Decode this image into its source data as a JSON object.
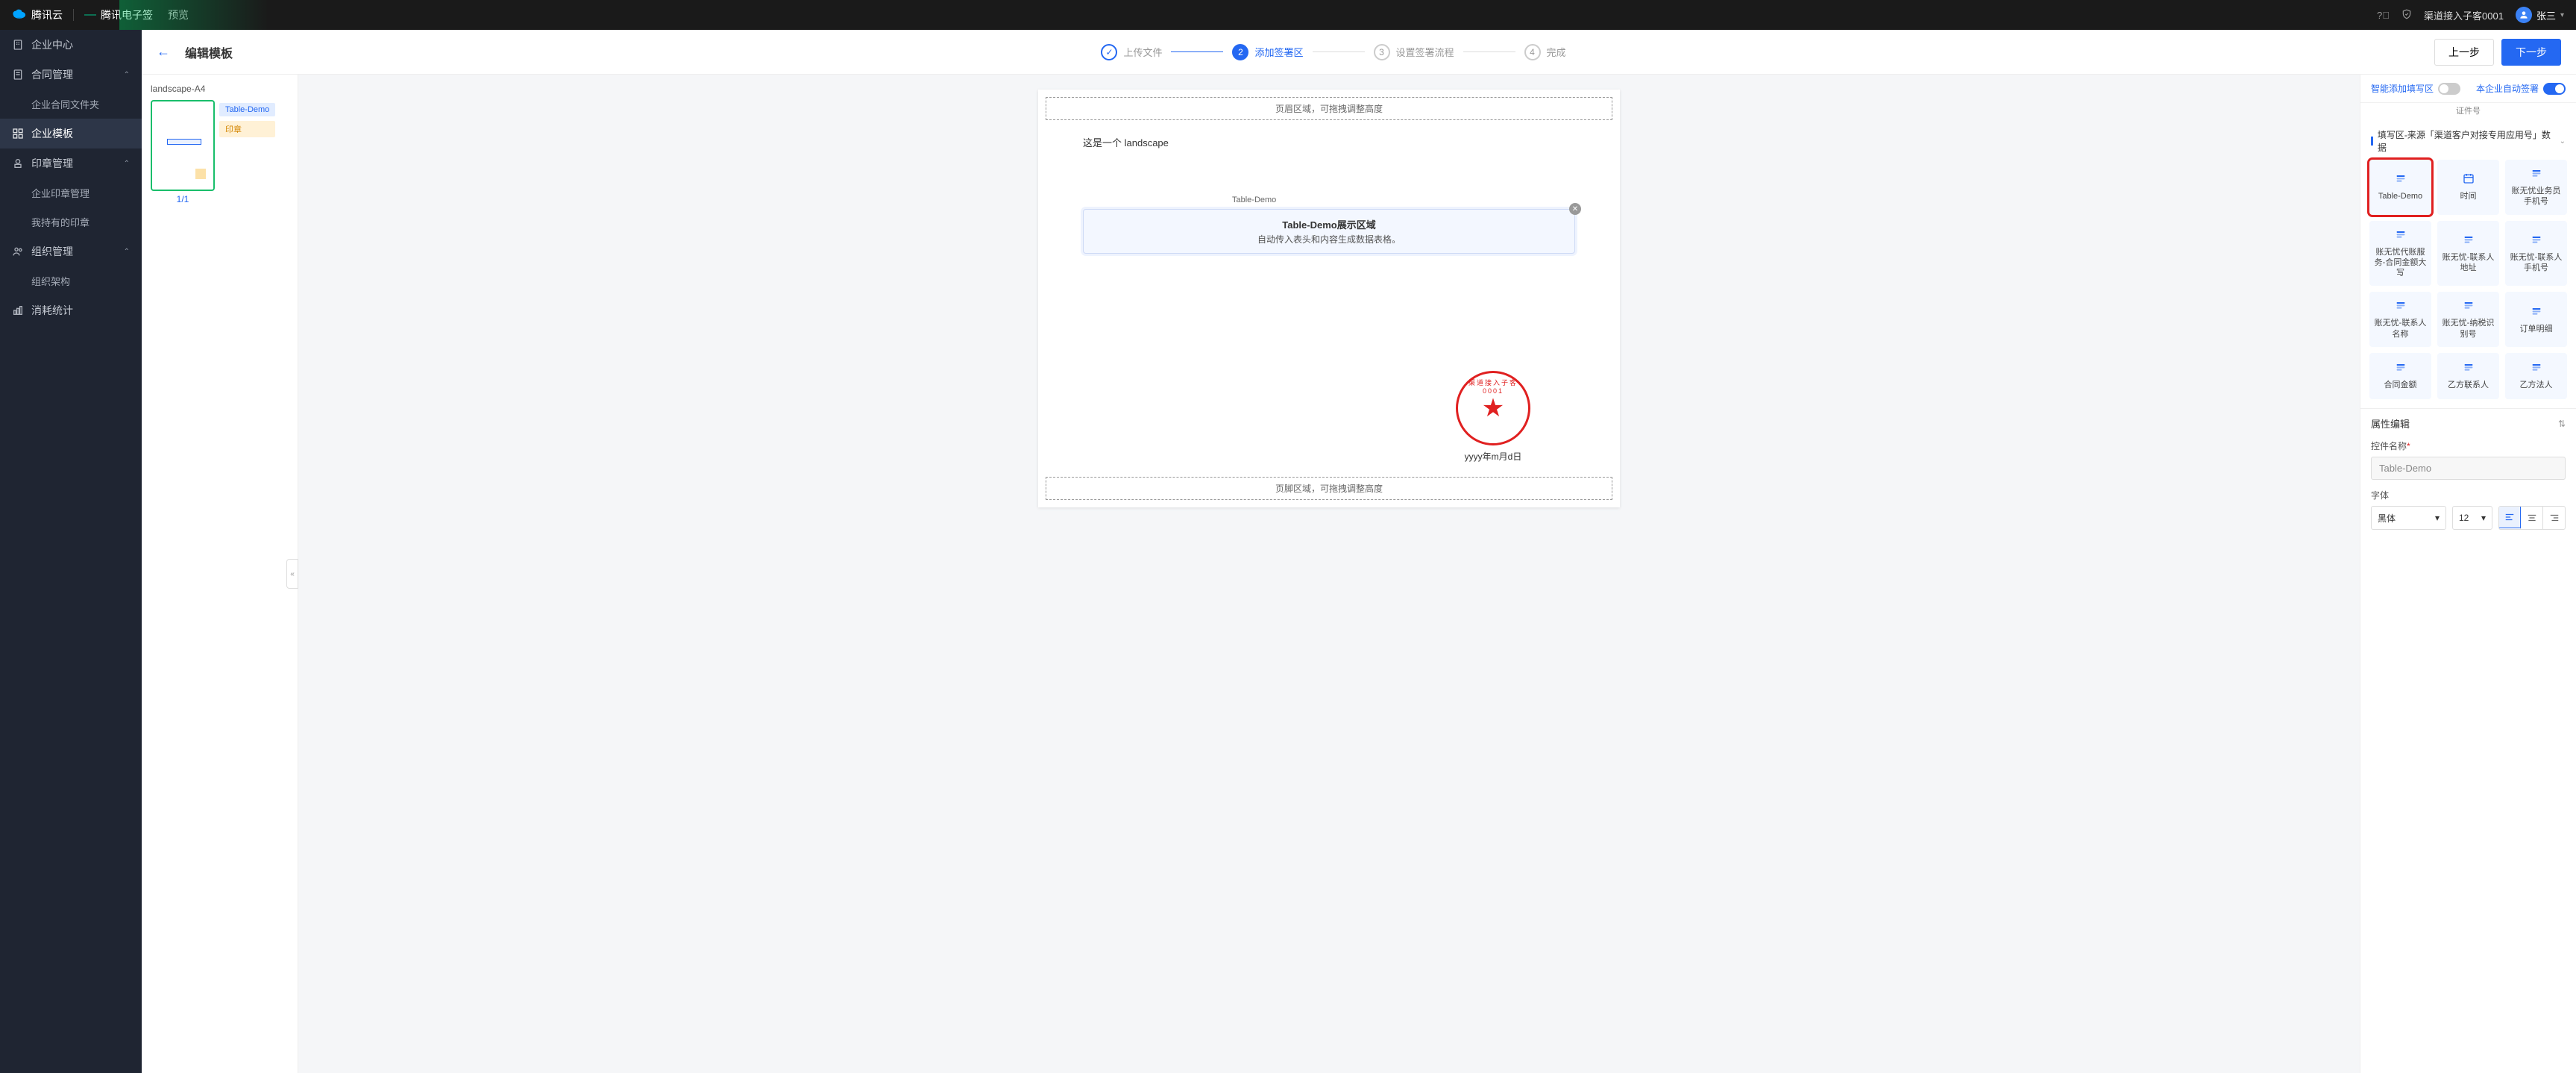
{
  "topbar": {
    "brand": "腾讯云",
    "product": "腾讯电子签",
    "mode": "预览",
    "org": "渠道接入子客0001",
    "username": "张三"
  },
  "sidebar": {
    "items": [
      {
        "label": "企业中心",
        "icon": "building",
        "type": "item"
      },
      {
        "label": "合同管理",
        "icon": "doc",
        "type": "group",
        "expanded": true
      },
      {
        "label": "企业合同文件夹",
        "type": "child"
      },
      {
        "label": "企业模板",
        "icon": "grid",
        "type": "item",
        "active": true
      },
      {
        "label": "印章管理",
        "icon": "stamp",
        "type": "group",
        "expanded": true
      },
      {
        "label": "企业印章管理",
        "type": "child"
      },
      {
        "label": "我持有的印章",
        "type": "child"
      },
      {
        "label": "组织管理",
        "icon": "users",
        "type": "group",
        "expanded": true
      },
      {
        "label": "组织架构",
        "type": "child"
      },
      {
        "label": "消耗统计",
        "icon": "chart",
        "type": "item"
      }
    ]
  },
  "header": {
    "title": "编辑模板",
    "steps": [
      {
        "label": "上传文件",
        "state": "done"
      },
      {
        "label": "添加签署区",
        "state": "active",
        "num": "2"
      },
      {
        "label": "设置签署流程",
        "state": "pending",
        "num": "3"
      },
      {
        "label": "完成",
        "state": "pending",
        "num": "4"
      }
    ],
    "prev": "上一步",
    "next": "下一步"
  },
  "thumb": {
    "docName": "landscape-A4",
    "pageNum": "1/1",
    "tags": [
      "Table-Demo",
      "印章"
    ]
  },
  "canvas": {
    "headerZone": "页眉区域，可拖拽调整高度",
    "footerZone": "页脚区域，可拖拽调整高度",
    "bodyText": "这是一个 landscape",
    "widget": {
      "label": "Table-Demo",
      "title": "Table-Demo展示区域",
      "desc": "自动传入表头和内容生成数据表格。"
    },
    "sealText": "渠道接入子客0001",
    "sealDate": "yyyy年m月d日"
  },
  "inspector": {
    "smartAdd": "智能添加填写区",
    "autoSign": "本企业自动签署",
    "idLabel": "证件号",
    "sectionTitle": "填写区-来源「渠道客户对接专用应用号」数据",
    "tiles": [
      {
        "label": "Table-Demo",
        "icon": "form",
        "highlight": true
      },
      {
        "label": "时间",
        "icon": "calendar"
      },
      {
        "label": "账无忧业务员手机号",
        "icon": "form"
      },
      {
        "label": "账无忧代账服务-合同金额大写",
        "icon": "form"
      },
      {
        "label": "账无忧-联系人地址",
        "icon": "form"
      },
      {
        "label": "账无忧-联系人手机号",
        "icon": "form"
      },
      {
        "label": "账无忧-联系人名称",
        "icon": "form"
      },
      {
        "label": "账无忧-纳税识别号",
        "icon": "form"
      },
      {
        "label": "订单明细",
        "icon": "form"
      },
      {
        "label": "合同金额",
        "icon": "form"
      },
      {
        "label": "乙方联系人",
        "icon": "form"
      },
      {
        "label": "乙方法人",
        "icon": "form"
      }
    ],
    "propTitle": "属性编辑",
    "controlNameLabel": "控件名称",
    "controlNameValue": "Table-Demo",
    "fontLabel": "字体",
    "fontFamily": "黑体",
    "fontSize": "12"
  }
}
